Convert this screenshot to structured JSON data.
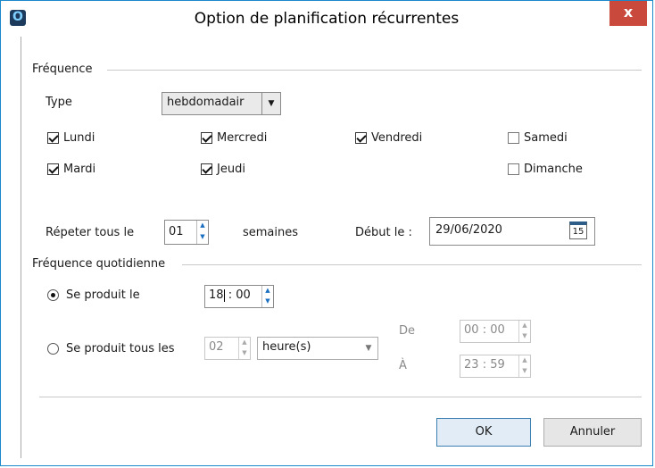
{
  "window": {
    "title": "Option de planification récurrentes",
    "close_label": "x",
    "app_icon_glyph": "O"
  },
  "frequence": {
    "section_title": "Fréquence",
    "type_label": "Type",
    "type_value": "hebdomadair",
    "days": [
      {
        "label": "Lundi",
        "checked": true
      },
      {
        "label": "Mercredi",
        "checked": true
      },
      {
        "label": "Vendredi",
        "checked": true
      },
      {
        "label": "Samedi",
        "checked": false
      },
      {
        "label": "Mardi",
        "checked": true
      },
      {
        "label": "Jeudi",
        "checked": true
      },
      {
        "label": "Dimanche",
        "checked": false
      }
    ],
    "repeat_label": "Répeter tous le",
    "repeat_value": "01",
    "repeat_unit": "semaines",
    "start_label": "Début le :",
    "start_value": "29/06/2020",
    "calendar_day": "15"
  },
  "quotidienne": {
    "section_title": "Fréquence quotidienne",
    "once_label": "Se produit le",
    "once_selected": true,
    "once_hour": "18",
    "once_minute": "00",
    "every_label": "Se produit tous les",
    "every_selected": false,
    "every_value": "02",
    "every_unit": "heure(s)",
    "from_label": "De",
    "from_hour": "00",
    "from_minute": "00",
    "to_label": "À",
    "to_hour": "23",
    "to_minute": "59",
    "time_sep": ":"
  },
  "buttons": {
    "ok": "OK",
    "cancel": "Annuler"
  },
  "colors": {
    "accent_border": "#1a88c9",
    "close_bg": "#c9493c",
    "spinner_arrow": "#1a6fc0"
  }
}
